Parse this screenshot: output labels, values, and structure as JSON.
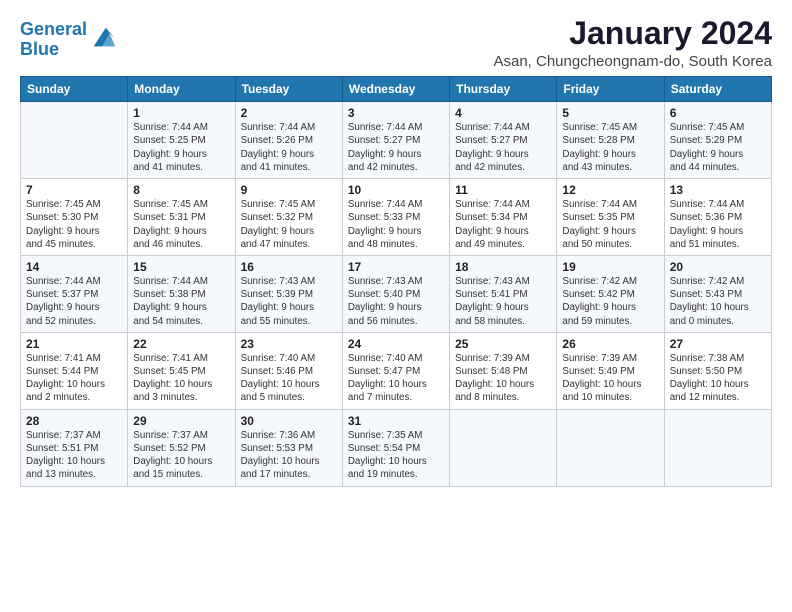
{
  "logo": {
    "line1": "General",
    "line2": "Blue"
  },
  "title": "January 2024",
  "subtitle": "Asan, Chungcheongnam-do, South Korea",
  "days_of_week": [
    "Sunday",
    "Monday",
    "Tuesday",
    "Wednesday",
    "Thursday",
    "Friday",
    "Saturday"
  ],
  "weeks": [
    [
      {
        "day": "",
        "info": ""
      },
      {
        "day": "1",
        "info": "Sunrise: 7:44 AM\nSunset: 5:25 PM\nDaylight: 9 hours\nand 41 minutes."
      },
      {
        "day": "2",
        "info": "Sunrise: 7:44 AM\nSunset: 5:26 PM\nDaylight: 9 hours\nand 41 minutes."
      },
      {
        "day": "3",
        "info": "Sunrise: 7:44 AM\nSunset: 5:27 PM\nDaylight: 9 hours\nand 42 minutes."
      },
      {
        "day": "4",
        "info": "Sunrise: 7:44 AM\nSunset: 5:27 PM\nDaylight: 9 hours\nand 42 minutes."
      },
      {
        "day": "5",
        "info": "Sunrise: 7:45 AM\nSunset: 5:28 PM\nDaylight: 9 hours\nand 43 minutes."
      },
      {
        "day": "6",
        "info": "Sunrise: 7:45 AM\nSunset: 5:29 PM\nDaylight: 9 hours\nand 44 minutes."
      }
    ],
    [
      {
        "day": "7",
        "info": "Sunrise: 7:45 AM\nSunset: 5:30 PM\nDaylight: 9 hours\nand 45 minutes."
      },
      {
        "day": "8",
        "info": "Sunrise: 7:45 AM\nSunset: 5:31 PM\nDaylight: 9 hours\nand 46 minutes."
      },
      {
        "day": "9",
        "info": "Sunrise: 7:45 AM\nSunset: 5:32 PM\nDaylight: 9 hours\nand 47 minutes."
      },
      {
        "day": "10",
        "info": "Sunrise: 7:44 AM\nSunset: 5:33 PM\nDaylight: 9 hours\nand 48 minutes."
      },
      {
        "day": "11",
        "info": "Sunrise: 7:44 AM\nSunset: 5:34 PM\nDaylight: 9 hours\nand 49 minutes."
      },
      {
        "day": "12",
        "info": "Sunrise: 7:44 AM\nSunset: 5:35 PM\nDaylight: 9 hours\nand 50 minutes."
      },
      {
        "day": "13",
        "info": "Sunrise: 7:44 AM\nSunset: 5:36 PM\nDaylight: 9 hours\nand 51 minutes."
      }
    ],
    [
      {
        "day": "14",
        "info": "Sunrise: 7:44 AM\nSunset: 5:37 PM\nDaylight: 9 hours\nand 52 minutes."
      },
      {
        "day": "15",
        "info": "Sunrise: 7:44 AM\nSunset: 5:38 PM\nDaylight: 9 hours\nand 54 minutes."
      },
      {
        "day": "16",
        "info": "Sunrise: 7:43 AM\nSunset: 5:39 PM\nDaylight: 9 hours\nand 55 minutes."
      },
      {
        "day": "17",
        "info": "Sunrise: 7:43 AM\nSunset: 5:40 PM\nDaylight: 9 hours\nand 56 minutes."
      },
      {
        "day": "18",
        "info": "Sunrise: 7:43 AM\nSunset: 5:41 PM\nDaylight: 9 hours\nand 58 minutes."
      },
      {
        "day": "19",
        "info": "Sunrise: 7:42 AM\nSunset: 5:42 PM\nDaylight: 9 hours\nand 59 minutes."
      },
      {
        "day": "20",
        "info": "Sunrise: 7:42 AM\nSunset: 5:43 PM\nDaylight: 10 hours\nand 0 minutes."
      }
    ],
    [
      {
        "day": "21",
        "info": "Sunrise: 7:41 AM\nSunset: 5:44 PM\nDaylight: 10 hours\nand 2 minutes."
      },
      {
        "day": "22",
        "info": "Sunrise: 7:41 AM\nSunset: 5:45 PM\nDaylight: 10 hours\nand 3 minutes."
      },
      {
        "day": "23",
        "info": "Sunrise: 7:40 AM\nSunset: 5:46 PM\nDaylight: 10 hours\nand 5 minutes."
      },
      {
        "day": "24",
        "info": "Sunrise: 7:40 AM\nSunset: 5:47 PM\nDaylight: 10 hours\nand 7 minutes."
      },
      {
        "day": "25",
        "info": "Sunrise: 7:39 AM\nSunset: 5:48 PM\nDaylight: 10 hours\nand 8 minutes."
      },
      {
        "day": "26",
        "info": "Sunrise: 7:39 AM\nSunset: 5:49 PM\nDaylight: 10 hours\nand 10 minutes."
      },
      {
        "day": "27",
        "info": "Sunrise: 7:38 AM\nSunset: 5:50 PM\nDaylight: 10 hours\nand 12 minutes."
      }
    ],
    [
      {
        "day": "28",
        "info": "Sunrise: 7:37 AM\nSunset: 5:51 PM\nDaylight: 10 hours\nand 13 minutes."
      },
      {
        "day": "29",
        "info": "Sunrise: 7:37 AM\nSunset: 5:52 PM\nDaylight: 10 hours\nand 15 minutes."
      },
      {
        "day": "30",
        "info": "Sunrise: 7:36 AM\nSunset: 5:53 PM\nDaylight: 10 hours\nand 17 minutes."
      },
      {
        "day": "31",
        "info": "Sunrise: 7:35 AM\nSunset: 5:54 PM\nDaylight: 10 hours\nand 19 minutes."
      },
      {
        "day": "",
        "info": ""
      },
      {
        "day": "",
        "info": ""
      },
      {
        "day": "",
        "info": ""
      }
    ]
  ]
}
